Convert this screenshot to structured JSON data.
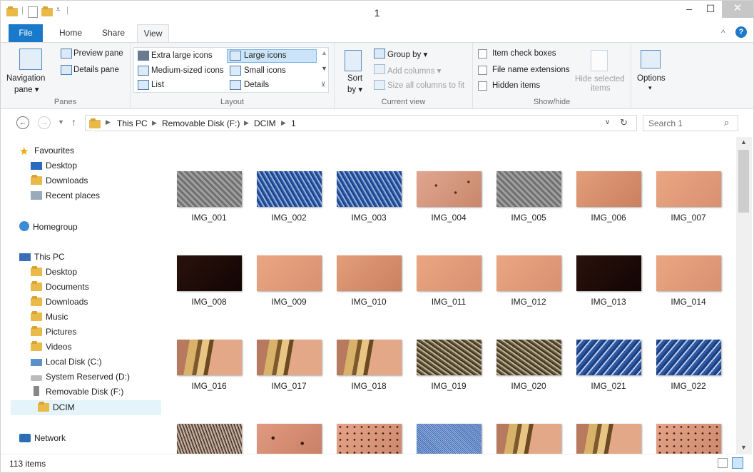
{
  "window": {
    "title": "1",
    "minimize": "–",
    "maximize": "☐",
    "close": "✕"
  },
  "tabs": {
    "file": "File",
    "home": "Home",
    "share": "Share",
    "view": "View"
  },
  "ribbon": {
    "panes": {
      "label": "Panes",
      "navigation_pane": "Navigation",
      "navigation_pane2": "pane ▾",
      "preview_pane": "Preview pane",
      "details_pane": "Details pane"
    },
    "layout": {
      "label": "Layout",
      "extra_large": "Extra large icons",
      "large": "Large icons",
      "medium": "Medium-sized icons",
      "small": "Small icons",
      "list": "List",
      "details": "Details"
    },
    "current_view": {
      "label": "Current view",
      "sort_by": "Sort",
      "sort_by2": "by ▾",
      "group_by": "Group by ▾",
      "add_columns": "Add columns ▾",
      "size_all": "Size all columns to fit"
    },
    "show_hide": {
      "label": "Show/hide",
      "item_check_boxes": "Item check boxes",
      "file_name_extensions": "File name extensions",
      "hidden_items": "Hidden items",
      "hide_selected": "Hide selected",
      "hide_selected2": "items"
    },
    "options": {
      "label": "Options",
      "arrow": "▾"
    }
  },
  "address": {
    "crumbs": [
      "This PC",
      "Removable Disk (F:)",
      "DCIM",
      "1"
    ],
    "search_placeholder": "Search 1"
  },
  "nav": {
    "favourites": "Favourites",
    "fav_items": [
      "Desktop",
      "Downloads",
      "Recent places"
    ],
    "homegroup": "Homegroup",
    "this_pc": "This PC",
    "pc_items": [
      "Desktop",
      "Documents",
      "Downloads",
      "Music",
      "Pictures",
      "Videos",
      "Local Disk (C:)",
      "System Reserved (D:)",
      "Removable Disk (F:)",
      "DCIM"
    ],
    "network": "Network"
  },
  "files": [
    {
      "name": "IMG_001",
      "tex": "t-check"
    },
    {
      "name": "IMG_002",
      "tex": "t-denim"
    },
    {
      "name": "IMG_003",
      "tex": "t-denim"
    },
    {
      "name": "IMG_004",
      "tex": "t-hair"
    },
    {
      "name": "IMG_005",
      "tex": "t-check"
    },
    {
      "name": "IMG_006",
      "tex": "t-skin"
    },
    {
      "name": "IMG_007",
      "tex": "t-skin2"
    },
    {
      "name": "IMG_008",
      "tex": "t-dark"
    },
    {
      "name": "IMG_009",
      "tex": "t-skin2"
    },
    {
      "name": "IMG_010",
      "tex": "t-skin"
    },
    {
      "name": "IMG_011",
      "tex": "t-skin2"
    },
    {
      "name": "IMG_012",
      "tex": "t-skin2"
    },
    {
      "name": "IMG_013",
      "tex": "t-dark"
    },
    {
      "name": "IMG_014",
      "tex": "t-skin2"
    },
    {
      "name": "IMG_016",
      "tex": "t-ring"
    },
    {
      "name": "IMG_017",
      "tex": "t-ring"
    },
    {
      "name": "IMG_018",
      "tex": "t-ring"
    },
    {
      "name": "IMG_019",
      "tex": "t-tweed"
    },
    {
      "name": "IMG_020",
      "tex": "t-tweed"
    },
    {
      "name": "IMG_021",
      "tex": "t-denim2"
    },
    {
      "name": "IMG_022",
      "tex": "t-denim2"
    },
    {
      "name": "",
      "tex": "t-hairy"
    },
    {
      "name": "",
      "tex": "t-mole"
    },
    {
      "name": "",
      "tex": "t-dots"
    },
    {
      "name": "",
      "tex": "t-denim3"
    },
    {
      "name": "",
      "tex": "t-ring"
    },
    {
      "name": "",
      "tex": "t-ring"
    },
    {
      "name": "",
      "tex": "t-dots"
    }
  ],
  "status": {
    "items_count": "113 items"
  }
}
